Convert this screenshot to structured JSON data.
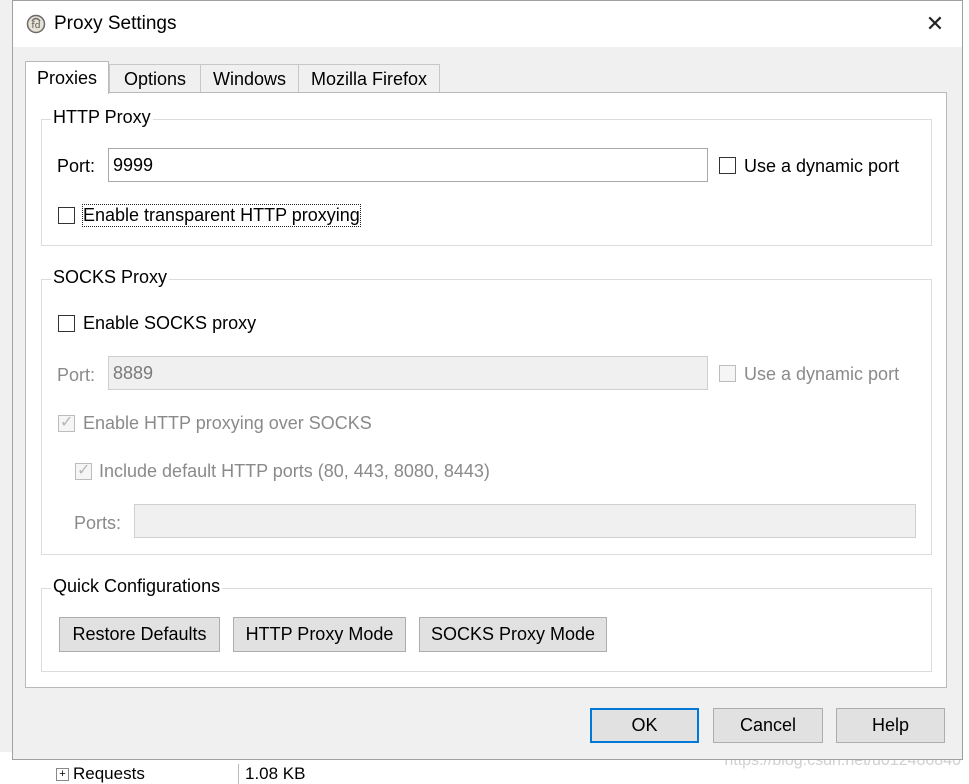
{
  "window": {
    "title": "Proxy Settings",
    "app_icon": "fiddler-app-icon",
    "close_icon": "close-icon"
  },
  "tabs": [
    {
      "label": "Proxies",
      "active": true
    },
    {
      "label": "Options",
      "active": false
    },
    {
      "label": "Windows",
      "active": false
    },
    {
      "label": "Mozilla Firefox",
      "active": false
    }
  ],
  "http_proxy": {
    "group_title": "HTTP Proxy",
    "port_label": "Port:",
    "port_value": "9999",
    "dynamic_port_label": "Use a dynamic port",
    "dynamic_port_checked": false,
    "transparent_label": "Enable transparent HTTP proxying",
    "transparent_checked": false
  },
  "socks_proxy": {
    "group_title": "SOCKS Proxy",
    "enable_label": "Enable SOCKS proxy",
    "enable_checked": false,
    "port_label": "Port:",
    "port_value": "8889",
    "dynamic_port_label": "Use a dynamic port",
    "http_over_socks_label": "Enable HTTP proxying over SOCKS",
    "http_over_socks_checked": true,
    "include_ports_label": "Include default HTTP ports (80, 443, 8080, 8443)",
    "include_ports_checked": true,
    "ports_label": "Ports:",
    "ports_value": ""
  },
  "quick_config": {
    "group_title": "Quick Configurations",
    "restore_defaults": "Restore Defaults",
    "http_proxy_mode": "HTTP Proxy Mode",
    "socks_proxy_mode": "SOCKS Proxy Mode"
  },
  "footer": {
    "ok": "OK",
    "cancel": "Cancel",
    "help": "Help"
  },
  "background": {
    "tree_expander": "+",
    "tree_item": "Requests",
    "tree_item_size": "1.08 KB",
    "watermark": "https://blog.csdn.net/u012486840"
  },
  "colors": {
    "focus_border": "#0078d7",
    "dialog_bg": "#f0f0f0",
    "panel_bg": "#ffffff",
    "disabled_text": "#8a8a8a"
  }
}
